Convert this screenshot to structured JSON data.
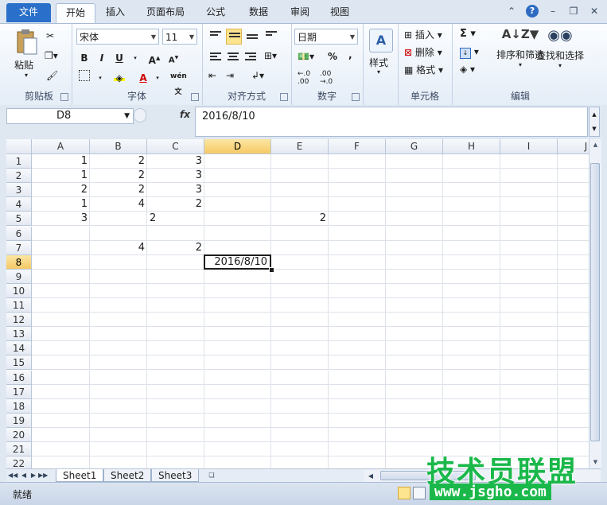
{
  "tabs": [
    {
      "label": "文件",
      "type": "file"
    },
    {
      "label": "开始",
      "active": true
    },
    {
      "label": "插入"
    },
    {
      "label": "页面布局"
    },
    {
      "label": "公式"
    },
    {
      "label": "数据"
    },
    {
      "label": "审阅"
    },
    {
      "label": "视图"
    }
  ],
  "groups": {
    "clipboard": {
      "label": "剪贴板",
      "paste": "粘贴"
    },
    "font": {
      "label": "字体",
      "font_name": "宋体",
      "font_size": "11"
    },
    "alignment": {
      "label": "对齐方式"
    },
    "number": {
      "label": "数字",
      "format": "日期",
      "percent": "%",
      "comma": ","
    },
    "styles": {
      "label": "样式"
    },
    "cells": {
      "label": "单元格",
      "insert": "插入",
      "delete": "删除",
      "format": "格式"
    },
    "editing": {
      "label": "编辑",
      "sort_filter": "排序和筛选",
      "find_select": "查找和选择",
      "sigma": "Σ"
    }
  },
  "formula_bar": {
    "name_box": "D8",
    "fx": "fx",
    "content": "2016/8/10"
  },
  "columns": [
    "A",
    "B",
    "C",
    "D",
    "E",
    "F",
    "G",
    "H",
    "I",
    "J"
  ],
  "rows": [
    "1",
    "2",
    "3",
    "4",
    "5",
    "6",
    "7",
    "8",
    "9",
    "10",
    "11",
    "12",
    "13",
    "14",
    "15",
    "16",
    "17",
    "18",
    "19",
    "20",
    "21",
    "22"
  ],
  "cells": [
    {
      "r": 0,
      "c": 0,
      "v": "1"
    },
    {
      "r": 0,
      "c": 1,
      "v": "2"
    },
    {
      "r": 0,
      "c": 2,
      "v": "3"
    },
    {
      "r": 1,
      "c": 0,
      "v": "1"
    },
    {
      "r": 1,
      "c": 1,
      "v": "2"
    },
    {
      "r": 1,
      "c": 2,
      "v": "3"
    },
    {
      "r": 2,
      "c": 0,
      "v": "2"
    },
    {
      "r": 2,
      "c": 1,
      "v": "2"
    },
    {
      "r": 2,
      "c": 2,
      "v": "3"
    },
    {
      "r": 3,
      "c": 0,
      "v": "1"
    },
    {
      "r": 3,
      "c": 1,
      "v": "4"
    },
    {
      "r": 3,
      "c": 2,
      "v": "2"
    },
    {
      "r": 4,
      "c": 0,
      "v": "3"
    },
    {
      "r": 4,
      "c": 2,
      "v": "2",
      "align": "left"
    },
    {
      "r": 4,
      "c": 4,
      "v": "2"
    },
    {
      "r": 6,
      "c": 1,
      "v": "4"
    },
    {
      "r": 6,
      "c": 2,
      "v": "2"
    }
  ],
  "active_cell": {
    "r": 7,
    "c": 3,
    "v": "2016/8/10"
  },
  "sheets": [
    {
      "label": "Sheet1",
      "active": true
    },
    {
      "label": "Sheet2"
    },
    {
      "label": "Sheet3"
    }
  ],
  "status": {
    "text": "就绪"
  },
  "watermark": {
    "title": "技术员联盟",
    "url": "www.jsgho.com"
  }
}
